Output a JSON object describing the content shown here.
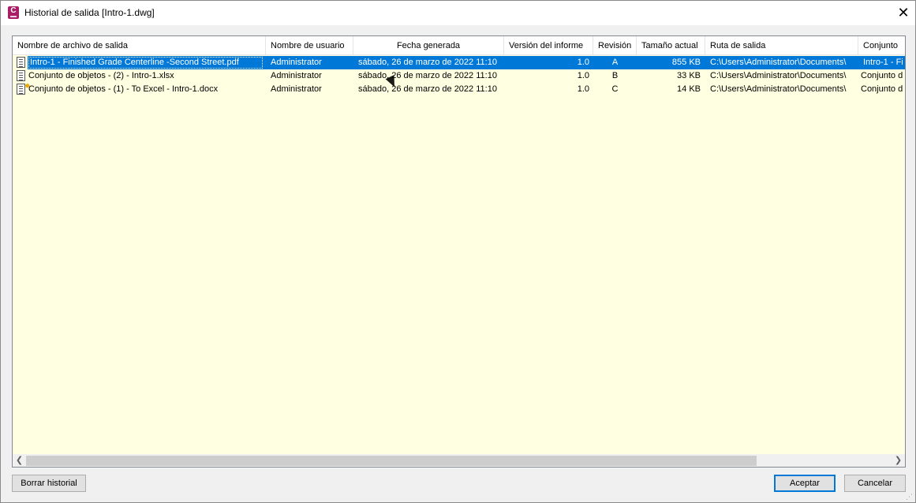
{
  "window": {
    "title": "Historial de salida [Intro-1.dwg]",
    "app_icon_letter": "C",
    "close_icon": "close-icon"
  },
  "table": {
    "columns": [
      "Nombre de archivo de salida",
      "Nombre de usuario",
      "Fecha generada",
      "Versión del informe",
      "Revisión",
      "Tamaño actual",
      "Ruta de salida",
      "Conjunto"
    ],
    "rows": [
      {
        "name": "Intro-1 - Finished Grade Centerline -Second Street.pdf",
        "user": "Administrator",
        "date": "sábado, 26 de marzo de 2022 11:10",
        "version": "1.0",
        "revision": "A",
        "size": "855 KB",
        "path": "C:\\Users\\Administrator\\Documents\\",
        "set": "Intro-1 - Fi",
        "icon": "document-list-icon",
        "selected": true
      },
      {
        "name": "Conjunto de objetos - (2) - Intro-1.xlsx",
        "user": "Administrator",
        "date": "sábado, 26 de marzo de 2022 11:10",
        "version": "1.0",
        "revision": "B",
        "size": "33 KB",
        "path": "C:\\Users\\Administrator\\Documents\\",
        "set": "Conjunto d",
        "icon": "document-list-icon",
        "selected": false
      },
      {
        "name": "Conjunto de objetos - (1) - To Excel - Intro-1.docx",
        "user": "Administrator",
        "date": "sábado, 26 de marzo de 2022 11:10",
        "version": "1.0",
        "revision": "C",
        "size": "14 KB",
        "path": "C:\\Users\\Administrator\\Documents\\",
        "set": "Conjunto d",
        "icon": "document-new-icon",
        "selected": false
      }
    ]
  },
  "buttons": {
    "clear_history": "Borrar historial",
    "accept": "Aceptar",
    "cancel": "Cancelar"
  },
  "colors": {
    "list_background": "#ffffe1",
    "selection": "#0078d7",
    "app_icon": "#a81d66"
  }
}
